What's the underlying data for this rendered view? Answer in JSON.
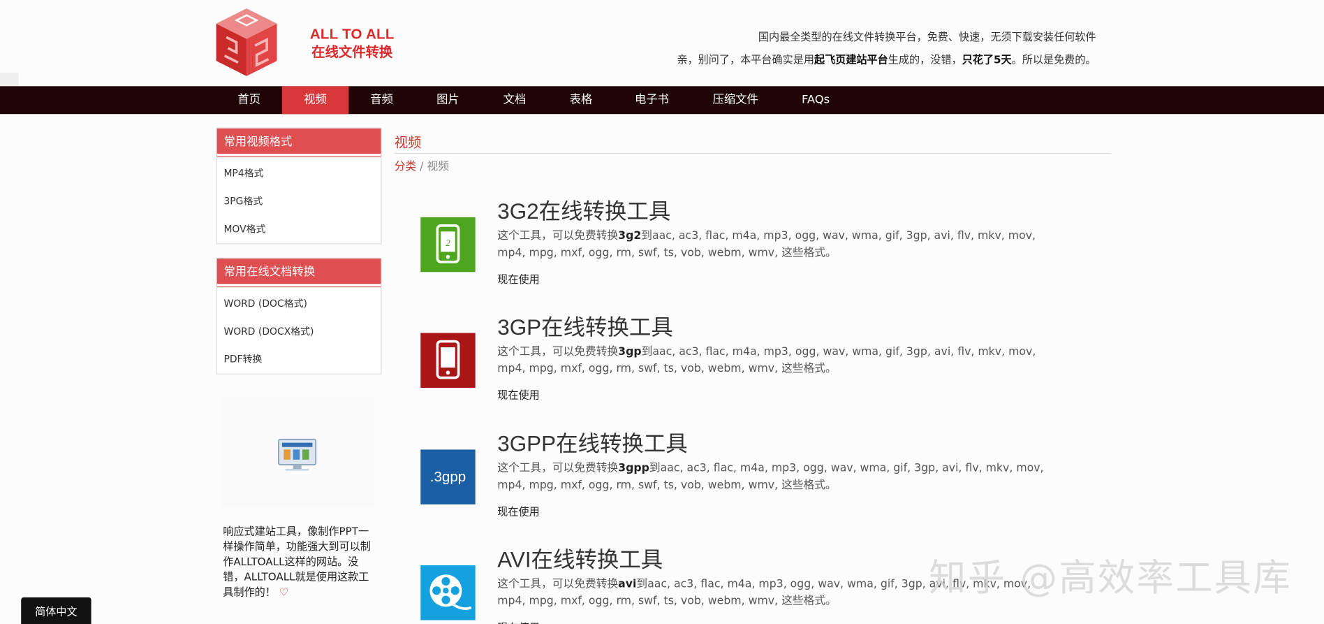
{
  "logo": {
    "line1": "ALL TO ALL",
    "line2": "在线文件转换"
  },
  "header": {
    "tagline1": "国内最全类型的在线文件转换平台，免费、快速，无须下载安装任何软件",
    "tagline2_a": "亲，别问了，本平台确实是用",
    "tagline2_b": "起飞页建站平台",
    "tagline2_c": "生成的，没错，",
    "tagline2_d": "只花了5天",
    "tagline2_e": "。所以是免费的。"
  },
  "nav": {
    "items": [
      "首页",
      "视频",
      "音频",
      "图片",
      "文档",
      "表格",
      "电子书",
      "压缩文件",
      "FAQs"
    ],
    "active": "视频"
  },
  "sidebar": {
    "video": {
      "title": "常用视频格式",
      "items": [
        "MP4格式",
        "3PG格式",
        "MOV格式"
      ]
    },
    "docs": {
      "title": "常用在线文档转换",
      "items": [
        "WORD (DOC格式)",
        "WORD (DOCX格式)",
        "PDF转换"
      ]
    },
    "promo": "响应式建站工具，像制作PPT一样操作简单，功能强大到可以制作ALLTOALL这样的网站。没错，ALLTOALL就是使用这款工具制作的！"
  },
  "main": {
    "title": "视频",
    "breadcrumb": {
      "link": "分类",
      "sep": "/",
      "current": "视频"
    },
    "desc_prefix": "这个工具，可以免费转换",
    "desc_suffix": "到aac, ac3, flac, m4a, mp3, ogg, wav, wma, gif, 3gp, avi, flv, mkv, mov, mp4, mpg, mxf, ogg, rm, swf, ts, vob, webm, wmv, 这些格式。",
    "use_label": "现在使用",
    "tools": [
      {
        "name": "3G2在线转换工具",
        "format": "3g2",
        "icon": "phone-icon-green",
        "icon_text": "2",
        "color": "#4ea61f"
      },
      {
        "name": "3GP在线转换工具",
        "format": "3gp",
        "icon": "phone-icon-red",
        "icon_text": "",
        "color": "#a81616"
      },
      {
        "name": "3GPP在线转换工具",
        "format": "3gpp",
        "icon": "3gpp-icon",
        "icon_text": ".3gpp",
        "color": "#1a5ea3"
      },
      {
        "name": "AVI在线转换工具",
        "format": "avi",
        "icon": "film-reel-icon",
        "icon_text": "",
        "color": "#15a0e0"
      }
    ]
  },
  "watermark": "知乎 @高效率工具库",
  "language_button": "简体中文",
  "colors": {
    "accent": "#d8383a",
    "nav_bg": "#200505",
    "sidebar_head": "#df4f52",
    "link": "#c0392b"
  }
}
